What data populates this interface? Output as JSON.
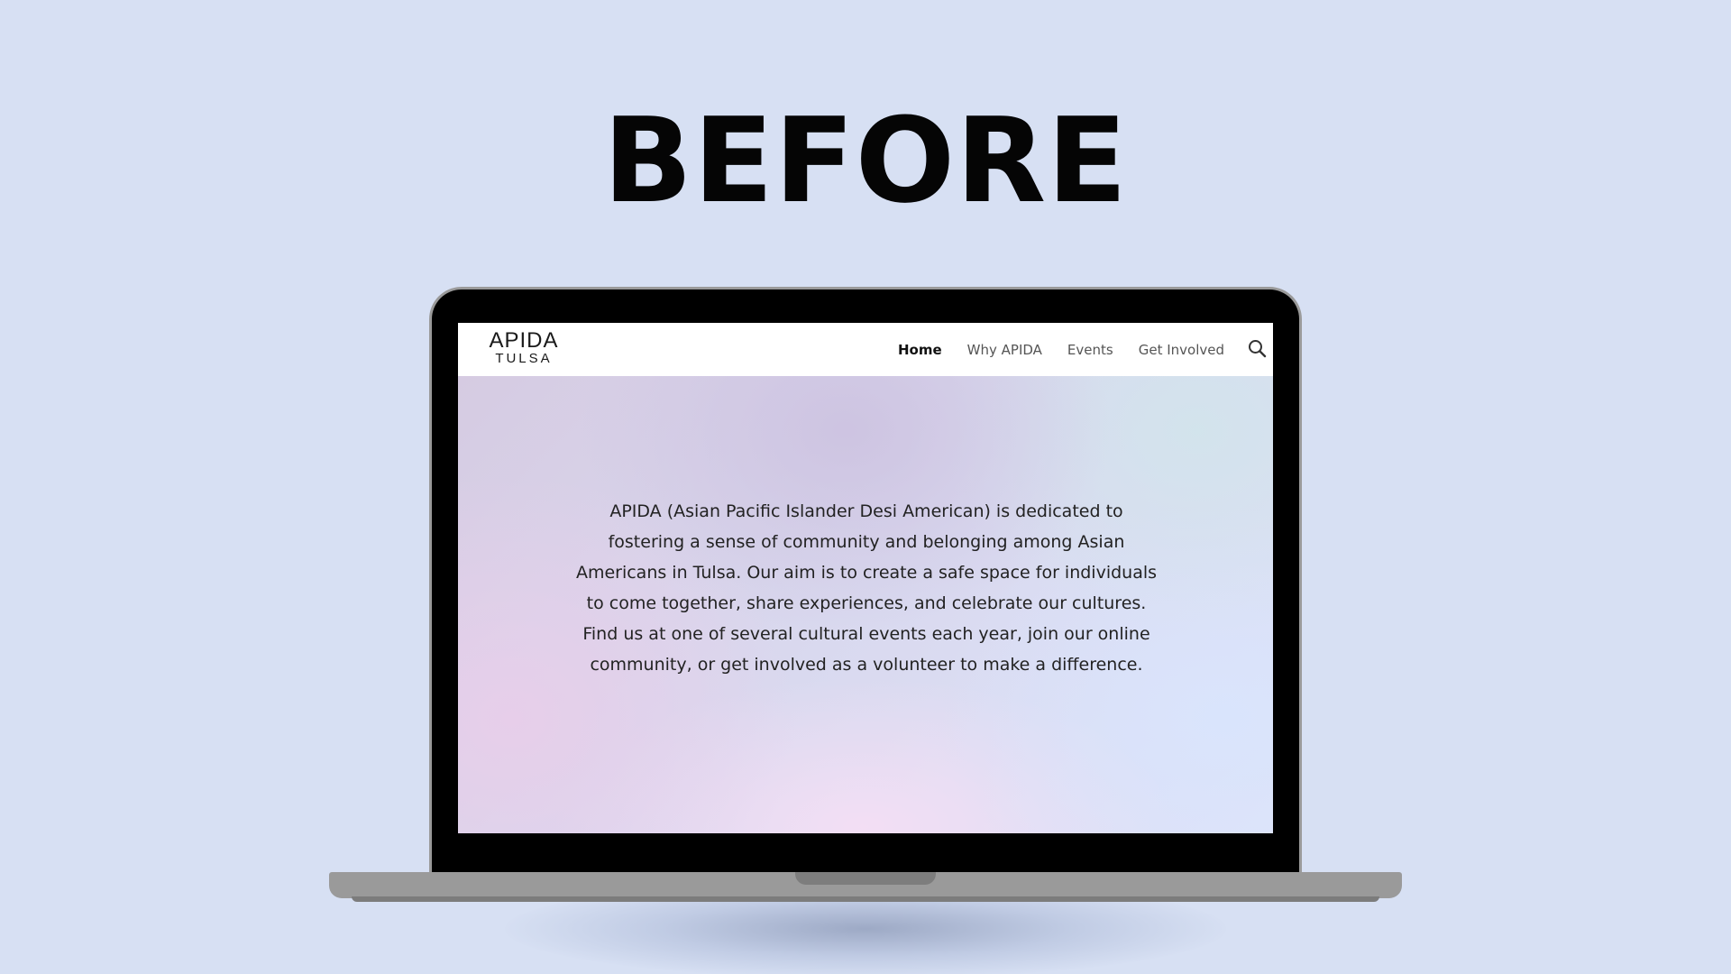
{
  "headline": "BEFORE",
  "site": {
    "logo": {
      "line1": "APIDA",
      "line2": "TULSA"
    },
    "nav": {
      "items": [
        {
          "label": "Home",
          "active": true
        },
        {
          "label": "Why APIDA",
          "active": false
        },
        {
          "label": "Events",
          "active": false
        },
        {
          "label": "Get Involved",
          "active": false
        }
      ],
      "search_icon": "search-icon"
    },
    "hero": {
      "text": "APIDA (Asian Pacific Islander Desi American) is dedicated to fostering a sense of community and belonging among Asian Americans in Tulsa. Our aim is to create a safe space for individuals to come together, share experiences, and celebrate our cultures. Find us at one of several cultural events each year, join our online community, or get involved as a volunteer to make a difference."
    }
  },
  "colors": {
    "background": "#d7e0f3",
    "laptop_bezel": "#000000",
    "laptop_body": "#9a9a9a",
    "nav_active": "#111111",
    "nav_inactive": "#555555"
  }
}
